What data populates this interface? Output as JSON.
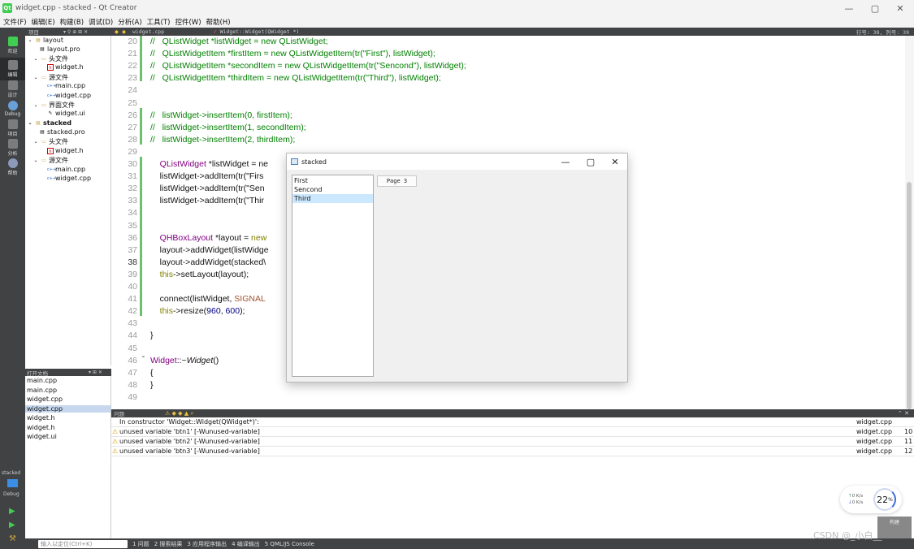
{
  "window": {
    "title": "widget.cpp - stacked - Qt Creator",
    "app_icon": "Qt",
    "controls": [
      "—",
      "▢",
      "✕"
    ]
  },
  "menu": [
    "文件(F)",
    "编辑(E)",
    "构建(B)",
    "调试(D)",
    "分析(A)",
    "工具(T)",
    "控件(W)",
    "帮助(H)"
  ],
  "modes": [
    "欢迎",
    "编辑",
    "设计",
    "Debug",
    "项目",
    "分析",
    "帮助"
  ],
  "kit": {
    "name": "stacked",
    "mode": "Debug"
  },
  "project_panel": {
    "header": "项目",
    "tree": [
      {
        "label": "layout",
        "icon": "project-folder-icon",
        "bold": false
      },
      {
        "label": "layout.pro",
        "icon": "pro-file-icon"
      },
      {
        "label": "头文件",
        "icon": "folder-icon"
      },
      {
        "label": "widget.h",
        "icon": "header-file-icon"
      },
      {
        "label": "源文件",
        "icon": "folder-icon"
      },
      {
        "label": "main.cpp",
        "icon": "cpp-file-icon"
      },
      {
        "label": "widget.cpp",
        "icon": "cpp-file-icon"
      },
      {
        "label": "界面文件",
        "icon": "folder-icon"
      },
      {
        "label": "widget.ui",
        "icon": "ui-file-icon"
      },
      {
        "label": "stacked",
        "icon": "project-folder-icon",
        "bold": true
      },
      {
        "label": "stacked.pro",
        "icon": "pro-file-icon"
      },
      {
        "label": "头文件",
        "icon": "folder-icon"
      },
      {
        "label": "widget.h",
        "icon": "header-file-icon"
      },
      {
        "label": "源文件",
        "icon": "folder-icon"
      },
      {
        "label": "main.cpp",
        "icon": "cpp-file-icon"
      },
      {
        "label": "widget.cpp",
        "icon": "cpp-file-icon"
      }
    ]
  },
  "open_docs": {
    "header": "打开文档",
    "items": [
      "main.cpp",
      "main.cpp",
      "widget.cpp",
      "widget.cpp",
      "widget.h",
      "widget.h",
      "widget.ui"
    ],
    "selected": 3
  },
  "editor": {
    "file_tab": "widget.cpp",
    "symbol": "Widget::Widget(QWidget *)",
    "position": "行号: 38, 列号: 39",
    "lines": [
      {
        "n": "20",
        "parts": [
          {
            "c": "cm",
            "t": "//   QListWidget *listWidget = new QListWidget;"
          }
        ]
      },
      {
        "n": "21",
        "parts": [
          {
            "c": "cm",
            "t": "//   QListWidgetItem *firstItem = new QListWidgetItem(tr(\"First\"), listWidget);"
          }
        ]
      },
      {
        "n": "22",
        "parts": [
          {
            "c": "cm",
            "t": "//   QListWidgetItem *secondItem = new QListWidgetItem(tr(\"Sencond\"), listWidget);"
          }
        ]
      },
      {
        "n": "23",
        "parts": [
          {
            "c": "cm",
            "t": "//   QListWidgetItem *thirdItem = new QListWidgetItem(tr(\"Third\"), listWidget);"
          }
        ]
      },
      {
        "n": "24",
        "parts": []
      },
      {
        "n": "25",
        "parts": []
      },
      {
        "n": "26",
        "parts": [
          {
            "c": "cm",
            "t": "//   listWidget->insertItem(0, firstItem);"
          }
        ]
      },
      {
        "n": "27",
        "parts": [
          {
            "c": "cm",
            "t": "//   listWidget->insertItem(1, secondItem);"
          }
        ]
      },
      {
        "n": "28",
        "parts": [
          {
            "c": "cm",
            "t": "//   listWidget->insertItem(2, thirdItem);"
          }
        ]
      },
      {
        "n": "29",
        "parts": []
      },
      {
        "n": "30",
        "parts": [
          {
            "c": "",
            "t": "    "
          },
          {
            "c": "ty",
            "t": "QListWidget"
          },
          {
            "c": "",
            "t": " *listWidget = ne"
          }
        ]
      },
      {
        "n": "31",
        "parts": [
          {
            "c": "",
            "t": "    listWidget->addItem(tr(\"Firs"
          }
        ]
      },
      {
        "n": "32",
        "parts": [
          {
            "c": "",
            "t": "    listWidget->addItem(tr(\"Sen"
          }
        ]
      },
      {
        "n": "33",
        "parts": [
          {
            "c": "",
            "t": "    listWidget->addItem(tr(\"Thir"
          }
        ]
      },
      {
        "n": "34",
        "parts": []
      },
      {
        "n": "35",
        "parts": []
      },
      {
        "n": "36",
        "parts": [
          {
            "c": "",
            "t": "    "
          },
          {
            "c": "ty",
            "t": "QHBoxLayout"
          },
          {
            "c": "",
            "t": " *layout = "
          },
          {
            "c": "kw",
            "t": "new"
          }
        ]
      },
      {
        "n": "37",
        "parts": [
          {
            "c": "",
            "t": "    layout->addWidget(listWidge"
          }
        ]
      },
      {
        "n": "38",
        "parts": [
          {
            "c": "",
            "t": "    layout->addWidget(stacked\\"
          }
        ]
      },
      {
        "n": "39",
        "parts": [
          {
            "c": "",
            "t": "    "
          },
          {
            "c": "kw",
            "t": "this"
          },
          {
            "c": "",
            "t": "->setLayout(layout);"
          }
        ]
      },
      {
        "n": "40",
        "parts": []
      },
      {
        "n": "41",
        "parts": [
          {
            "c": "",
            "t": "    connect(listWidget, "
          },
          {
            "c": "mac",
            "t": "SIGNAL"
          }
        ]
      },
      {
        "n": "42",
        "parts": [
          {
            "c": "",
            "t": "    "
          },
          {
            "c": "kw",
            "t": "this"
          },
          {
            "c": "",
            "t": "->resize("
          },
          {
            "c": "num",
            "t": "960"
          },
          {
            "c": "",
            "t": ", "
          },
          {
            "c": "num",
            "t": "600"
          },
          {
            "c": "",
            "t": ");"
          }
        ]
      },
      {
        "n": "43",
        "parts": []
      },
      {
        "n": "44",
        "parts": [
          {
            "c": "",
            "t": "}"
          }
        ]
      },
      {
        "n": "45",
        "parts": []
      },
      {
        "n": "46",
        "parts": [
          {
            "c": "ty",
            "t": "Widget"
          },
          {
            "c": "",
            "t": "::~"
          },
          {
            "c": "it",
            "t": "Widget"
          },
          {
            "c": "",
            "t": "()"
          }
        ]
      },
      {
        "n": "47",
        "parts": [
          {
            "c": "",
            "t": "{"
          }
        ]
      },
      {
        "n": "48",
        "parts": [
          {
            "c": "",
            "t": "}"
          }
        ]
      },
      {
        "n": "49",
        "parts": []
      }
    ],
    "current_line": "38"
  },
  "issues": {
    "header": "问题",
    "rows": [
      {
        "warn": false,
        "msg": "In constructor 'Widget::Widget(QWidget*)':",
        "file": "widget.cpp",
        "line": ""
      },
      {
        "warn": true,
        "msg": "unused variable 'btn1' [-Wunused-variable]",
        "file": "widget.cpp",
        "line": "10"
      },
      {
        "warn": true,
        "msg": "unused variable 'btn2' [-Wunused-variable]",
        "file": "widget.cpp",
        "line": "11"
      },
      {
        "warn": true,
        "msg": "unused variable 'btn3' [-Wunused-variable]",
        "file": "widget.cpp",
        "line": "12"
      }
    ]
  },
  "statusbar": {
    "locator_placeholder": "输入以定位(Ctrl+K)",
    "tabs": [
      "1 问题",
      "2 搜索结果",
      "3 应用程序输出",
      "4 编译输出",
      "5 QML/JS Console"
    ]
  },
  "dialog": {
    "title": "stacked",
    "list_items": [
      "First",
      "Sencond",
      "Third"
    ],
    "selected_index": 2,
    "page_label": "Page 3"
  },
  "net_widget": {
    "up": "0 K/s",
    "down": "0 K/s",
    "percent": "22",
    "percent_unit": "%"
  },
  "build_label": "构建",
  "watermark": "CSDN @_小白__"
}
